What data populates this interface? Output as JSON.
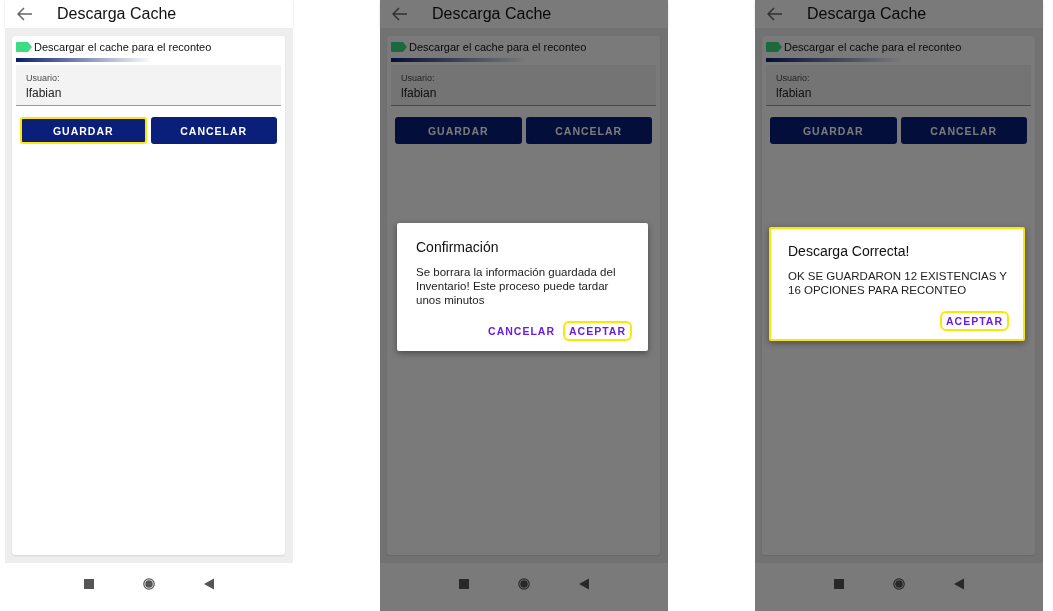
{
  "screens": [
    {
      "title": "Descarga Cache",
      "card_label": "Descargar el cache para el reconteo",
      "field": {
        "label": "Usuario:",
        "value": "lfabian"
      },
      "buttons": [
        {
          "label": "GUARDAR",
          "highlighted": true
        },
        {
          "label": "CANCELAR",
          "highlighted": false
        }
      ]
    },
    {
      "title": "Descarga Cache",
      "card_label": "Descargar el cache para el reconteo",
      "field": {
        "label": "Usuario:",
        "value": "lfabian"
      },
      "buttons": [
        {
          "label": "GUARDAR",
          "highlighted": false
        },
        {
          "label": "CANCELAR",
          "highlighted": false
        }
      ],
      "dialog": {
        "title": "Confirmación",
        "message": "Se borrara la información guardada del Inventario! Este proceso puede tardar unos minutos",
        "highlighted": false,
        "actions": [
          {
            "label": "CANCELAR",
            "highlighted": false
          },
          {
            "label": "ACEPTAR",
            "highlighted": true
          }
        ]
      }
    },
    {
      "title": "Descarga Cache",
      "card_label": "Descargar el cache para el reconteo",
      "field": {
        "label": "Usuario:",
        "value": "lfabian"
      },
      "buttons": [
        {
          "label": "GUARDAR",
          "highlighted": false
        },
        {
          "label": "CANCELAR",
          "highlighted": false
        }
      ],
      "dialog": {
        "title": "Descarga Correcta!",
        "message": "OK SE GUARDARON 12 EXISTENCIAS Y 16 OPCIONES PARA RECONTEO",
        "highlighted": true,
        "actions": [
          {
            "label": "ACEPTAR",
            "highlighted": true
          }
        ]
      }
    }
  ]
}
